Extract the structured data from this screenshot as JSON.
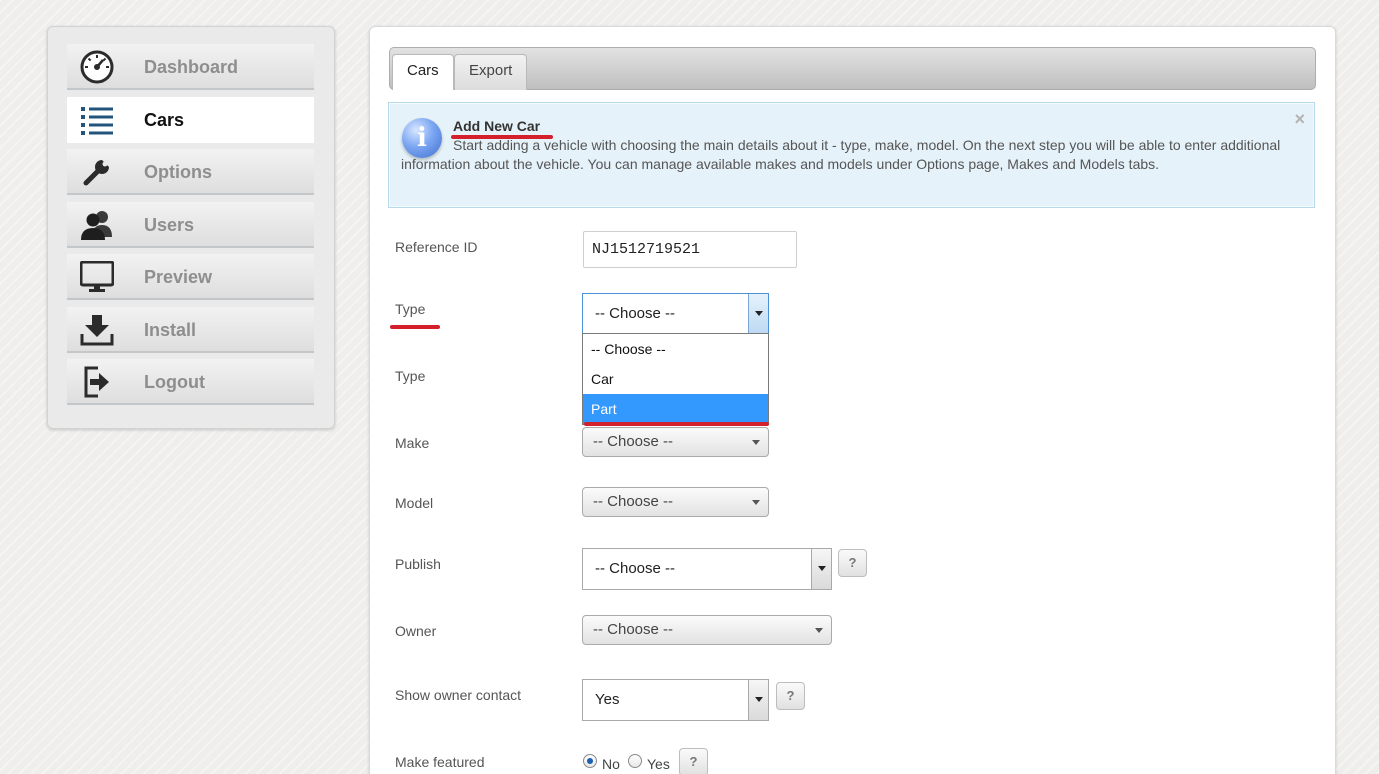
{
  "sidebar": {
    "items": [
      {
        "label": "Dashboard",
        "icon": "dashboard-gauge-icon"
      },
      {
        "label": "Cars",
        "icon": "list-icon",
        "active": true
      },
      {
        "label": "Options",
        "icon": "wrench-icon"
      },
      {
        "label": "Users",
        "icon": "users-icon"
      },
      {
        "label": "Preview",
        "icon": "monitor-icon"
      },
      {
        "label": "Install",
        "icon": "download-icon"
      },
      {
        "label": "Logout",
        "icon": "logout-icon"
      }
    ]
  },
  "tabs": [
    {
      "label": "Cars",
      "active": true
    },
    {
      "label": "Export",
      "active": false
    }
  ],
  "info": {
    "title": "Add New Car",
    "text": "Start adding a vehicle with choosing the main details about it - type, make, model. On the next step you will be able to enter additional information about the vehicle. You can manage available makes and models under Options page, Makes and Models tabs.",
    "close": "×",
    "icon": "info-icon"
  },
  "form": {
    "reference_id": {
      "label": "Reference ID",
      "value": "NJ1512719521"
    },
    "type1": {
      "label": "Type",
      "value": "-- Choose --",
      "options": [
        "-- Choose --",
        "Car",
        "Part"
      ],
      "highlighted": "Part"
    },
    "type2": {
      "label": "Type"
    },
    "make": {
      "label": "Make",
      "value": "-- Choose --"
    },
    "model": {
      "label": "Model",
      "value": "-- Choose --"
    },
    "publish": {
      "label": "Publish",
      "value": "-- Choose --",
      "help": "?"
    },
    "owner": {
      "label": "Owner",
      "value": "-- Choose --"
    },
    "show_owner_contact": {
      "label": "Show owner contact",
      "value": "Yes",
      "help": "?"
    },
    "make_featured": {
      "label": "Make featured",
      "options": [
        "No",
        "Yes"
      ],
      "selected": "No",
      "help": "?"
    }
  },
  "colors": {
    "accent_red": "#d4202b",
    "selected_blue": "#3399ff",
    "info_bg": "#e6f2f9"
  }
}
